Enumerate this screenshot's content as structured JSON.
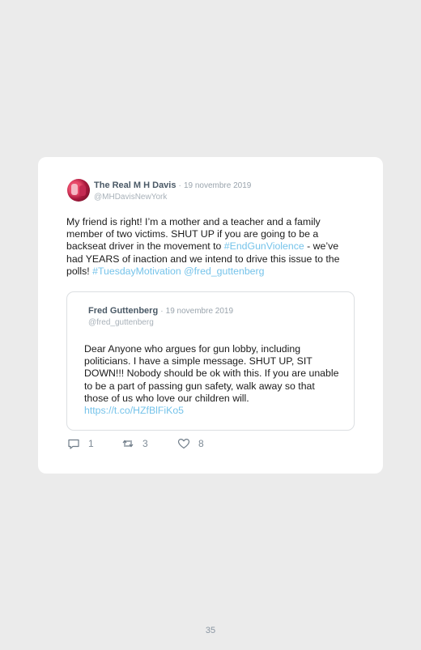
{
  "tweet": {
    "name": "The Real M H Davis",
    "separator": "·",
    "date": "19 novembre 2019",
    "handle": "@MHDavisNewYork",
    "text_parts": [
      "My friend is right! I’m a mother and a teacher and a family member of two victims. SHUT UP if you are going to be a backseat driver in the movement to ",
      "#EndGunViolence",
      " - we’ve had YEARS of inaction and we intend to drive this issue to the polls! ",
      "#TuesdayMotivation",
      " ",
      "@fred_guttenberg"
    ],
    "quoted": {
      "name": "Fred Guttenberg",
      "separator": "·",
      "date": "19 novembre 2019",
      "handle": "@fred_guttenberg",
      "text": "Dear Anyone who argues for gun lobby, including politicians. I have a simple message. SHUT UP, SIT DOWN!!! Nobody should be ok with this. If you are unable to be a part of passing gun safety, walk away so that those of us who love our children will.",
      "link": "https://t.co/HZfBlFiKo5"
    },
    "actions": {
      "replies": "1",
      "retweets": "3",
      "likes": "8"
    }
  },
  "page_number": "35",
  "colors": {
    "background": "#ebebeb",
    "card": "#ffffff",
    "link": "#75c3ea",
    "meta": "#9aa4ad"
  },
  "icons": [
    "reply-icon",
    "retweet-icon",
    "like-icon"
  ]
}
